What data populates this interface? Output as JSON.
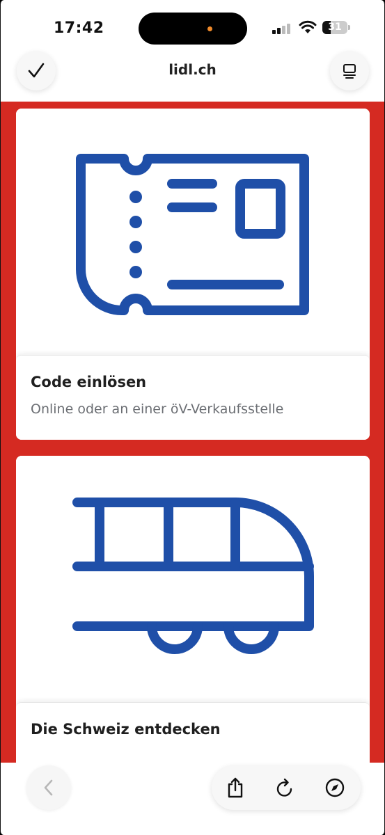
{
  "status_bar": {
    "time": "17:42",
    "battery": "31"
  },
  "browser": {
    "url": "lidl.ch",
    "done_icon": "checkmark-icon",
    "tabs_icon": "tab-overview-icon"
  },
  "colors": {
    "page_background": "#d52a22",
    "icon_blue": "#1f4fa8",
    "caption_gray": "#6b6e73"
  },
  "cards": [
    {
      "icon": "ticket-icon",
      "title": "Code einlösen",
      "subtitle": "Online oder an einer öV-Verkaufsstelle"
    },
    {
      "icon": "train-icon",
      "title": "Die Schweiz entdecken"
    }
  ],
  "bottom_bar": {
    "back_icon": "chevron-left-icon",
    "share_icon": "share-icon",
    "reload_icon": "reload-icon",
    "compass_icon": "compass-icon"
  }
}
